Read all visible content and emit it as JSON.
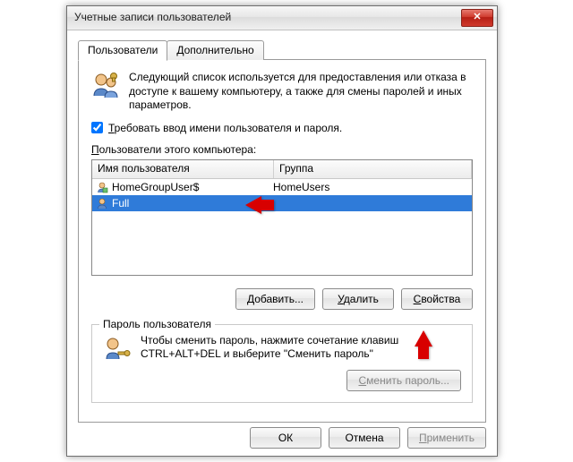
{
  "window": {
    "title": "Учетные записи пользователей"
  },
  "tabs": [
    {
      "label": "Пользователи",
      "active": true
    },
    {
      "label": "Дополнительно",
      "active": false
    }
  ],
  "intro_text": "Следующий список используется для предоставления или отказа в доступе к вашему компьютеру, а также для смены паролей и иных параметров.",
  "require_checkbox": {
    "checked": true,
    "prefix": "Т",
    "rest": "ребовать ввод имени пользователя и пароля."
  },
  "users_label_prefix": "П",
  "users_label_rest": "ользователи этого компьютера:",
  "listview": {
    "columns": {
      "user": "Имя пользователя",
      "group": "Группа"
    },
    "rows": [
      {
        "user": "HomeGroupUser$",
        "group": "HomeUsers",
        "selected": false
      },
      {
        "user": "Full",
        "group": "",
        "selected": true
      }
    ]
  },
  "buttons": {
    "add": {
      "prefix": "Д",
      "rest": "обавить..."
    },
    "remove": {
      "prefix": "У",
      "rest": "далить"
    },
    "properties": {
      "prefix": "С",
      "rest": "войства"
    }
  },
  "password_group": {
    "legend": "Пароль пользователя",
    "text": "Чтобы сменить пароль, нажмите сочетание клавиш CTRL+ALT+DEL и выберите \"Сменить пароль\"",
    "button": {
      "prefix": "С",
      "rest": "менить пароль..."
    },
    "button_enabled": false
  },
  "dialog_buttons": {
    "ok": "ОК",
    "cancel": "Отмена",
    "apply": {
      "prefix": "П",
      "rest": "рименить"
    },
    "apply_enabled": false
  }
}
